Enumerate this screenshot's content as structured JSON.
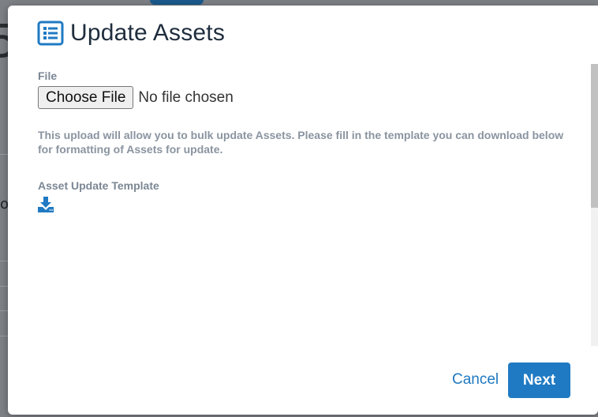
{
  "modal": {
    "title": "Update Assets",
    "title_icon": "list-alt-icon"
  },
  "file_field": {
    "label": "File",
    "button_label": "Choose File",
    "status": "No file chosen"
  },
  "help_text": "This upload will allow you to bulk update Assets. Please fill in the template you can download below for formatting of Assets for update.",
  "template": {
    "label": "Asset Update Template",
    "icon": "download-icon"
  },
  "footer": {
    "cancel_label": "Cancel",
    "next_label": "Next"
  },
  "colors": {
    "accent": "#1f7ac3",
    "title": "#1f2d3d",
    "muted_text": "#8a94a0"
  }
}
